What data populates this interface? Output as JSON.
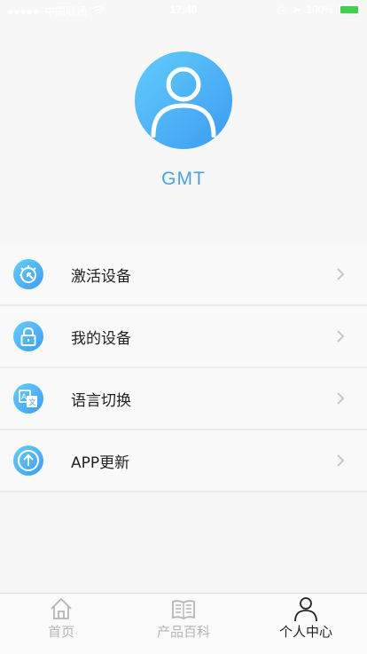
{
  "status_bar": {
    "carrier": "中国联通",
    "time": "17:40",
    "battery": "100%"
  },
  "profile": {
    "username": "GMT"
  },
  "menu": {
    "items": [
      {
        "label": "激活设备",
        "icon": "activate-icon"
      },
      {
        "label": "我的设备",
        "icon": "lock-icon"
      },
      {
        "label": "语言切换",
        "icon": "translate-icon"
      },
      {
        "label": "APP更新",
        "icon": "upload-icon"
      }
    ]
  },
  "tabs": [
    {
      "label": "首页",
      "icon": "home-icon"
    },
    {
      "label": "产品百科",
      "icon": "book-icon"
    },
    {
      "label": "个人中心",
      "icon": "person-icon",
      "active": true
    }
  ],
  "colors": {
    "accent": "#4b9fe5",
    "icon_gradient_start": "#61cdfb",
    "icon_gradient_end": "#3d9af2"
  }
}
